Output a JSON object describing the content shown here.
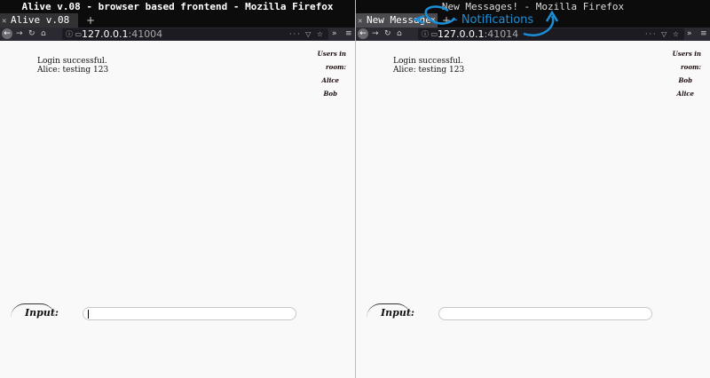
{
  "left_window": {
    "title": "Alive v.08 - browser based frontend - Mozilla Firefox",
    "tab_label": "Alive v.08",
    "tab_close": "×",
    "new_tab": "+",
    "url_host": "127.0.0.1",
    "url_port": ":41004",
    "messages": [
      "Login successful.",
      "Alice: testing 123"
    ],
    "users_heading_1": "Users in",
    "users_heading_2": "room:",
    "users": [
      "Alice",
      "Bob"
    ],
    "input_label": "Input:"
  },
  "right_window": {
    "title": "New Messages! - Mozilla Firefox",
    "tab_label": "New Message",
    "tab_close": "×",
    "new_tab": "+",
    "url_host": "127.0.0.1",
    "url_port": ":41014",
    "messages": [
      "Login successful.",
      "Alice: testing 123"
    ],
    "users_heading_1": "Users in",
    "users_heading_2": "room:",
    "users": [
      "Bob",
      "Alice"
    ],
    "input_label": "Input:"
  },
  "annotation": "- Notifications",
  "nav": {
    "back": "←",
    "forward": "→",
    "reload": "↻",
    "home": "⌂",
    "overflow": "»",
    "menu": "≡"
  },
  "icons": [
    "firefox-tab-icon",
    "info-icon",
    "back-arrow-icon",
    "forward-arrow-icon",
    "reload-icon",
    "home-icon",
    "menu-icon"
  ],
  "colors": {
    "annotation": "#1a8fd8",
    "titlebar": "#0c0c0d",
    "page": "#f9f9fa"
  }
}
